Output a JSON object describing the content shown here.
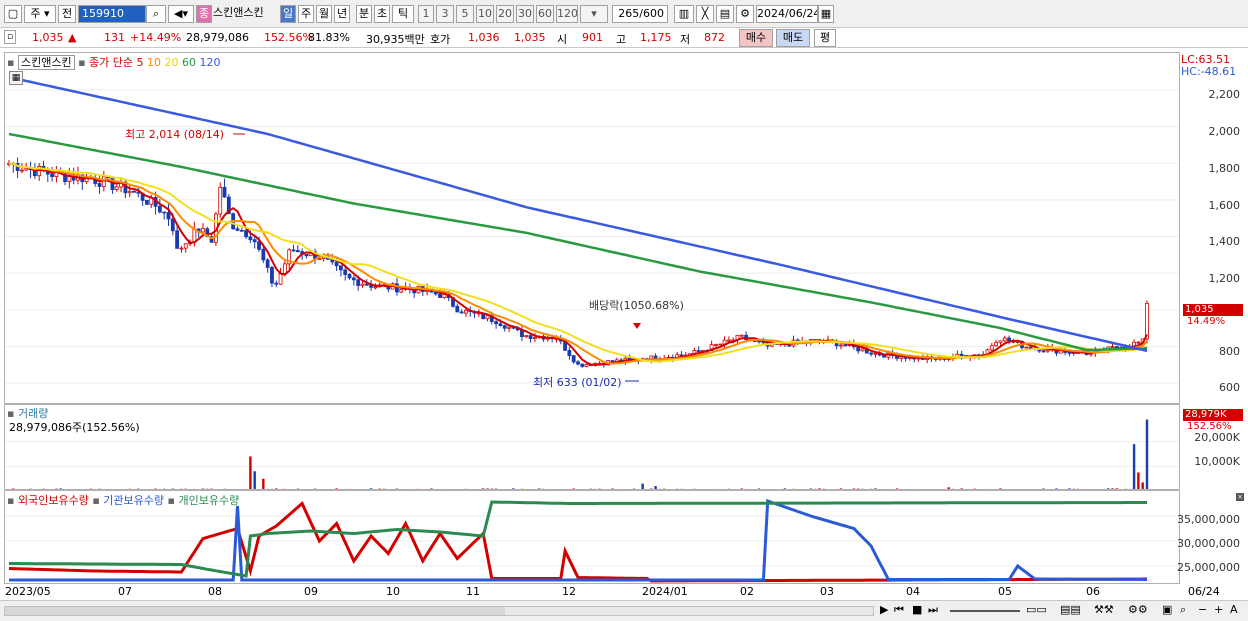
{
  "toolbar": {
    "period": "주",
    "jeon": "전",
    "code": "159910",
    "market": "종",
    "stock_name": "스킨앤스킨",
    "tabs": [
      "일",
      "주",
      "월",
      "년",
      "분",
      "초",
      "틱"
    ],
    "minutes": [
      "1",
      "3",
      "5",
      "10",
      "20",
      "30",
      "60",
      "120"
    ],
    "count": "265",
    "max": "/600",
    "date": "2024/06/24"
  },
  "quote": {
    "price": "1,035",
    "change": "131",
    "change_pct": "+14.49%",
    "volume": "28,979,086",
    "vol_pct": "152.56%",
    "rate": "81.83%",
    "amount": "30,935백만",
    "ask_label": "호가",
    "ask1": "1,036",
    "ask2": "1,035",
    "open_label": "시",
    "open": "901",
    "high_label": "고",
    "high": "1,175",
    "low_label": "저",
    "low": "872",
    "buy": "매수",
    "sell": "매도",
    "avg": "평"
  },
  "price_panel": {
    "name": "스킨앤스킨",
    "ma_label": "종가 단순",
    "ma_periods": [
      "5",
      "10",
      "20",
      "60",
      "120"
    ],
    "ma_colors": [
      "#d40000",
      "#ff8c00",
      "#f0e020",
      "#2a9a40",
      "#3a5ae0"
    ],
    "lc": "LC:63.51",
    "hc": "HC:-48.61",
    "y_ticks": [
      "2,200",
      "2,000",
      "1,800",
      "1,600",
      "1,400",
      "1,200",
      "800",
      "600"
    ],
    "cur_price": "1,035",
    "cur_pct": "14.49%",
    "max_label": "최고 2,014 (08/14)",
    "min_label": "최저 633 (01/02)",
    "div_label": "배당락(1050.68%)"
  },
  "volume_panel": {
    "title": "거래량",
    "value": "28,979,086주(152.56%)",
    "badge": "28,979K",
    "badge_pct": "152.56%",
    "y_ticks": [
      "20,000K",
      "10,000K"
    ]
  },
  "holding_panel": {
    "labels": [
      "외국인보유수량",
      "기관보유수량",
      "개인보유수량"
    ],
    "colors": [
      "#d40000",
      "#2a5ad8",
      "#2a8a50"
    ],
    "y_ticks": [
      "35,000,000",
      "30,000,000",
      "25,000,000"
    ]
  },
  "x_axis": [
    "2023/05",
    "07",
    "08",
    "09",
    "10",
    "11",
    "12",
    "2024/01",
    "02",
    "03",
    "04",
    "05",
    "06",
    "06/24"
  ],
  "chart_data": {
    "type": "line",
    "title": "",
    "x": [
      "2023/05",
      "07",
      "08",
      "09",
      "10",
      "11",
      "12",
      "2024/01",
      "02",
      "03",
      "04",
      "05",
      "06",
      "06/24"
    ],
    "series": [
      {
        "name": "종가",
        "values": [
          1800,
          1760,
          1450,
          1350,
          1120,
          1070,
          820,
          700,
          740,
          780,
          760,
          720,
          840,
          1035
        ]
      },
      {
        "name": "120",
        "values": [
          2270,
          2050,
          1880,
          1760,
          1620,
          1480,
          1320,
          1160,
          1000,
          860,
          810,
          790,
          770,
          770
        ]
      }
    ],
    "ylim": [
      600,
      2200
    ]
  }
}
